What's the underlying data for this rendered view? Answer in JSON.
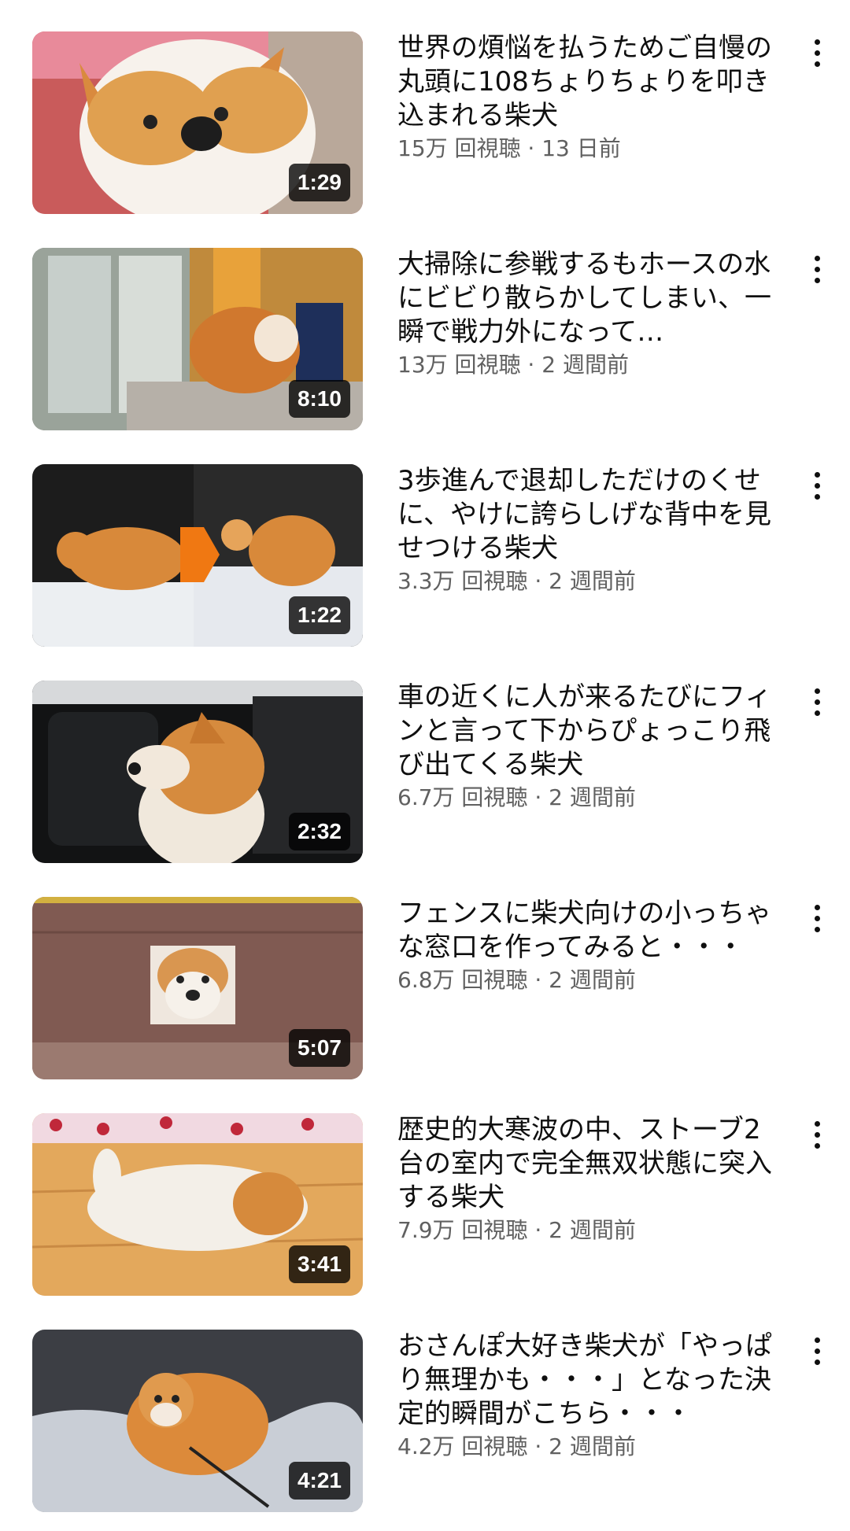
{
  "videos": [
    {
      "title": "世界の煩悩を払うためご自慢の丸頭に108ちょりちょりを叩き込まれる柴犬",
      "meta": "15万 回視聴 · 13 日前",
      "duration": "1:29",
      "scene": "closeup"
    },
    {
      "title": "大掃除に参戦するもホースの水にビビり散らかしてしまい、一瞬で戦力外になって…",
      "meta": "13万 回視聴 · 2 週間前",
      "duration": "8:10",
      "scene": "window"
    },
    {
      "title": "3歩進んで退却しただけのくせに、やけに誇らしげな背中を見せつける柴犬",
      "meta": "3.3万 回視聴 · 2 週間前",
      "duration": "1:22",
      "scene": "snow-pair"
    },
    {
      "title": "車の近くに人が来るたびにフィンと言って下からぴょっこり飛び出てくる柴犬",
      "meta": "6.7万 回視聴 · 2 週間前",
      "duration": "2:32",
      "scene": "car"
    },
    {
      "title": "フェンスに柴犬向けの小っちゃな窓口を作ってみると・・・",
      "meta": "6.8万 回視聴 · 2 週間前",
      "duration": "5:07",
      "scene": "box"
    },
    {
      "title": "歴史的大寒波の中、ストーブ2台の室内で完全無双状態に突入する柴犬",
      "meta": "7.9万 回視聴 · 2 週間前",
      "duration": "3:41",
      "scene": "floor"
    },
    {
      "title": "おさんぽ大好き柴犬が「やっぱり無理かも・・・」となった決定的瞬間がこちら・・・",
      "meta": "4.2万 回視聴 · 2 週間前",
      "duration": "4:21",
      "scene": "night-snow"
    }
  ],
  "icons": {
    "more": "more-vert-icon"
  },
  "colors": {
    "meta": "#606060",
    "title": "#0f0f0f",
    "duration_bg": "#000000"
  }
}
